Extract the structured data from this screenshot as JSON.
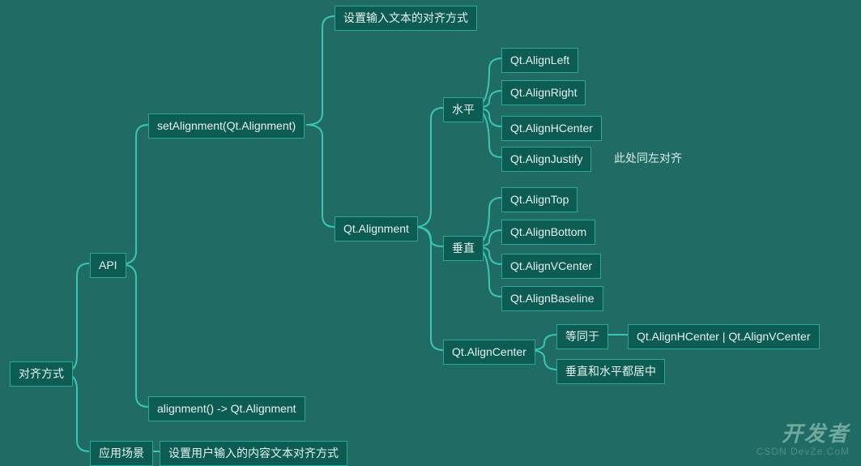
{
  "root": "对齐方式",
  "api_label": "API",
  "setAlignment": "setAlignment(Qt.Alignment)",
  "set_desc": "设置输入文本的对齐方式",
  "qtAlignment": "Qt.Alignment",
  "horizontal": "水平",
  "h_items": {
    "left": "Qt.AlignLeft",
    "right": "Qt.AlignRight",
    "hcenter": "Qt.AlignHCenter",
    "justify": "Qt.AlignJustify"
  },
  "justify_note": "此处同左对齐",
  "vertical": "垂直",
  "v_items": {
    "top": "Qt.AlignTop",
    "bottom": "Qt.AlignBottom",
    "vcenter": "Qt.AlignVCenter",
    "baseline": "Qt.AlignBaseline"
  },
  "alignCenter": "Qt.AlignCenter",
  "center_eq_label": "等同于",
  "center_eq_value": "Qt.AlignHCenter | Qt.AlignVCenter",
  "center_desc": "垂直和水平都居中",
  "alignment_get": "alignment() -> Qt.Alignment",
  "scenario_label": "应用场景",
  "scenario_desc": "设置用户输入的内容文本对齐方式",
  "watermark": "开发者",
  "watermark2": "CSDN DevZe.CoM"
}
